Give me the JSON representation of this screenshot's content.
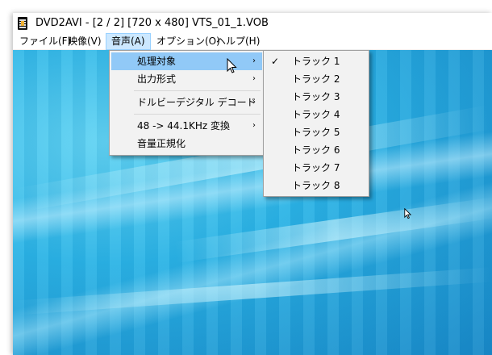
{
  "window": {
    "title": "DVD2AVI - [2 / 2] [720 x 480] VTS_01_1.VOB"
  },
  "menubar": {
    "items": [
      {
        "label": "ファイル(F)"
      },
      {
        "label": "映像(V)"
      },
      {
        "label": "音声(A)"
      },
      {
        "label": "オプション(O)"
      },
      {
        "label": "ヘルプ(H)"
      }
    ],
    "active": "音声(A)"
  },
  "audio_menu": {
    "items": [
      {
        "label": "処理対象",
        "has_submenu": true,
        "highlighted": true
      },
      {
        "label": "出力形式",
        "has_submenu": true
      },
      {
        "label": "ドルビーデジタル デコード",
        "has_submenu": true
      },
      {
        "label": "48 -> 44.1KHz 変換",
        "has_submenu": true
      },
      {
        "label": "音量正規化",
        "has_submenu": false
      }
    ],
    "arrow_glyph": "›"
  },
  "track_submenu": {
    "items": [
      {
        "label": "トラック 1",
        "checked": true
      },
      {
        "label": "トラック 2"
      },
      {
        "label": "トラック 3"
      },
      {
        "label": "トラック 4"
      },
      {
        "label": "トラック 5"
      },
      {
        "label": "トラック 6"
      },
      {
        "label": "トラック 7"
      },
      {
        "label": "トラック 8"
      }
    ],
    "check_glyph": "✓"
  },
  "colors": {
    "highlight": "#91c9f7",
    "menu_bg": "#f2f2f2",
    "active_menu": "#cce8ff",
    "video_blue": "#2bb4e6"
  },
  "icons": {
    "app": "film-strip-icon",
    "submenu": "chevron-right-icon",
    "check": "check-icon",
    "cursor": "mouse-pointer-icon"
  }
}
